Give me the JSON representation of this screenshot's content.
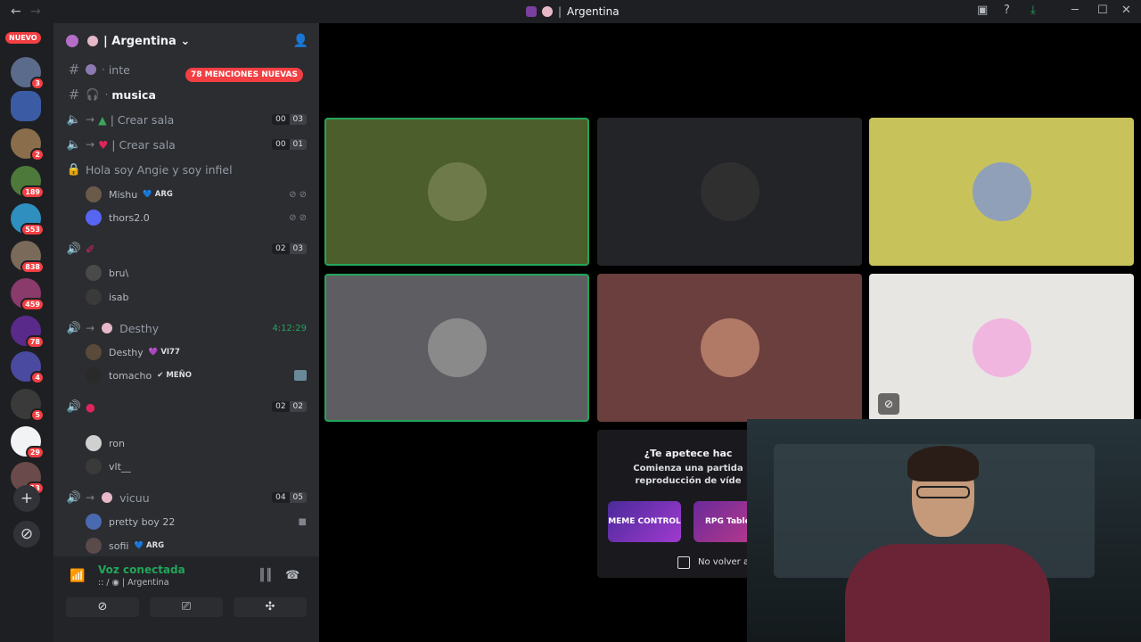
{
  "window": {
    "title": "Argentina",
    "back": "←",
    "forward": "→"
  },
  "rail": {
    "nuevo_label": "NUEVO",
    "servers": [
      {
        "badge": "3",
        "color": "#5a6b8c"
      },
      {
        "badge": "",
        "color": "#3b5ba5"
      },
      {
        "badge": "2",
        "color": "#8a6e4b"
      },
      {
        "badge": "189",
        "color": "#4d7a3a"
      },
      {
        "badge": "553",
        "color": "#2f8fbf"
      },
      {
        "badge": "838",
        "color": "#7a6a5a"
      },
      {
        "badge": "459",
        "color": "#8a3a6b"
      },
      {
        "badge": "78",
        "color": "#5a2a8a"
      },
      {
        "badge": "4",
        "color": "#4a4aa0"
      },
      {
        "badge": "5",
        "color": "#3a3a3a"
      },
      {
        "badge": "29",
        "color": "#f2f3f5"
      },
      {
        "badge": "13",
        "color": "#6a4a4a"
      }
    ],
    "add_label": "+",
    "discover_label": "⊘"
  },
  "guild": {
    "name": "Argentina",
    "chevron": "⌄",
    "mention_pill": "78 MENCIONES NUEVAS"
  },
  "channels": [
    {
      "type": "text",
      "prefix": "·",
      "name": "inte",
      "bright": false
    },
    {
      "type": "text",
      "prefix": "·",
      "name": "musica",
      "bright": true
    },
    {
      "type": "voice",
      "prefix": "→",
      "name": "| Crear sala",
      "count_a": "00",
      "count_b": "03"
    },
    {
      "type": "voice",
      "prefix": "→",
      "name": "| Crear sala",
      "count_a": "00",
      "count_b": "01"
    },
    {
      "type": "locked",
      "prefix": "",
      "name": "Hola soy Angie y soy infiel"
    }
  ],
  "room1_users": [
    {
      "name": "Mishu",
      "tag": "ARG",
      "color": "#6b5a4a"
    },
    {
      "name": "thors2.0",
      "tag": "",
      "color": "#5865f2"
    }
  ],
  "room2": {
    "count_a": "02",
    "count_b": "03"
  },
  "room2_users": [
    {
      "name": "bru\\",
      "color": "#4a4a4a"
    },
    {
      "name": "isab",
      "color": "#3a3a3a"
    }
  ],
  "room3": {
    "name": "Desthy",
    "timer": "4:12:29"
  },
  "room3_users": [
    {
      "name": "Desthy",
      "tag": "VI77",
      "color": "#5a4a3a"
    },
    {
      "name": "tomacho",
      "tag": "MEÑO",
      "color": "#2a2a2a"
    }
  ],
  "room4": {
    "count_a": "02",
    "count_b": "02"
  },
  "room4_users": [
    {
      "name": "ron",
      "color": "#d0d0d0"
    },
    {
      "name": "vlt__",
      "color": "#3a3a3a"
    }
  ],
  "room5": {
    "name": "vicuu",
    "count_a": "04",
    "count_b": "05"
  },
  "room5_users": [
    {
      "name": "pretty boy 22",
      "color": "#4a6ab0"
    },
    {
      "name": "sofii",
      "tag": "ARG",
      "color": "#5a4a4a"
    }
  ],
  "voice_panel": {
    "title": "Voz conectada",
    "subtitle": ":: / ◉ | Argentina"
  },
  "tiles": [
    {
      "bg": "#4b5e2b",
      "avatar": "#6f7a4a",
      "speaking": true
    },
    {
      "bg": "#232428",
      "avatar": "#2f2f2f",
      "speaking": false
    },
    {
      "bg": "#c8c25a",
      "avatar": "#8fa0b8",
      "speaking": false
    },
    {
      "bg": "#5e5e62",
      "avatar": "#8a8a8a",
      "speaking": true
    },
    {
      "bg": "#6b3f3d",
      "avatar": "#b07a66",
      "speaking": false
    },
    {
      "bg": "#e8e6e3",
      "avatar": "#f0b6e0",
      "speaking": false
    }
  ],
  "activity": {
    "title": "¿Te apetece hac",
    "subtitle_1": "Comienza una partida",
    "subtitle_2": "reproducción de víde",
    "card_1": "MEME CONTROL",
    "card_2": "RPG Tables",
    "checkbox_label": "No volver a"
  }
}
